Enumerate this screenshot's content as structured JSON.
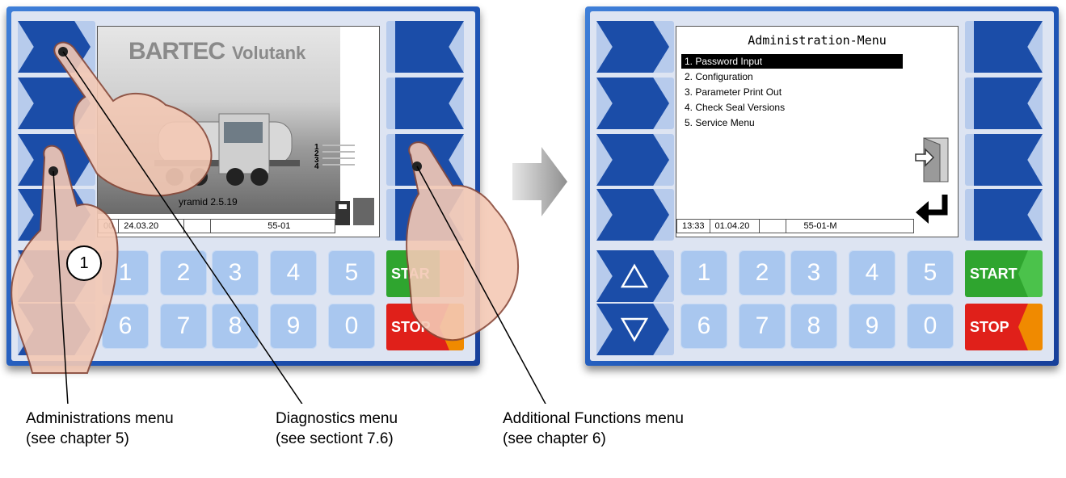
{
  "left_screen": {
    "brand": "BARTEC",
    "product": "Volutank",
    "version": "yramid 2.5.19",
    "status": [
      "00",
      "24.03.20",
      "",
      "55-01"
    ],
    "list_numbers": [
      "1",
      "2",
      "3",
      "4"
    ]
  },
  "right_screen": {
    "title": "Administration-Menu",
    "items": [
      "1.  Password Input",
      "2.  Configuration",
      "3.  Parameter Print Out",
      "4.  Check Seal Versions",
      "5.  Service Menu"
    ],
    "status": [
      "13:33",
      "01.04.20",
      "",
      "55-01-M"
    ]
  },
  "keypad": {
    "digits": [
      "1",
      "2",
      "3",
      "4",
      "5",
      "6",
      "7",
      "8",
      "9",
      "0"
    ],
    "start_label": "START",
    "stop_label": "STOP",
    "start_label_cut": "STAR"
  },
  "callout": {
    "number": "1"
  },
  "captions": {
    "admin": [
      "Administrations menu",
      "(see chapter 5)"
    ],
    "diag": [
      "Diagnostics menu",
      "(see sectiont 7.6)"
    ],
    "addl": [
      "Additional Functions menu",
      "(see chapter 6)"
    ]
  },
  "colors": {
    "panel": "#2560c4",
    "key_blue": "#1b4da8",
    "key_light": "#b7cbec",
    "start": "#2fa52f",
    "stop": "#e0201a",
    "stop_tab": "#f08a00"
  },
  "icons": [
    "up-arrow-icon",
    "down-arrow-icon",
    "exit-door-icon",
    "enter-return-icon",
    "arrow-right-icon"
  ]
}
